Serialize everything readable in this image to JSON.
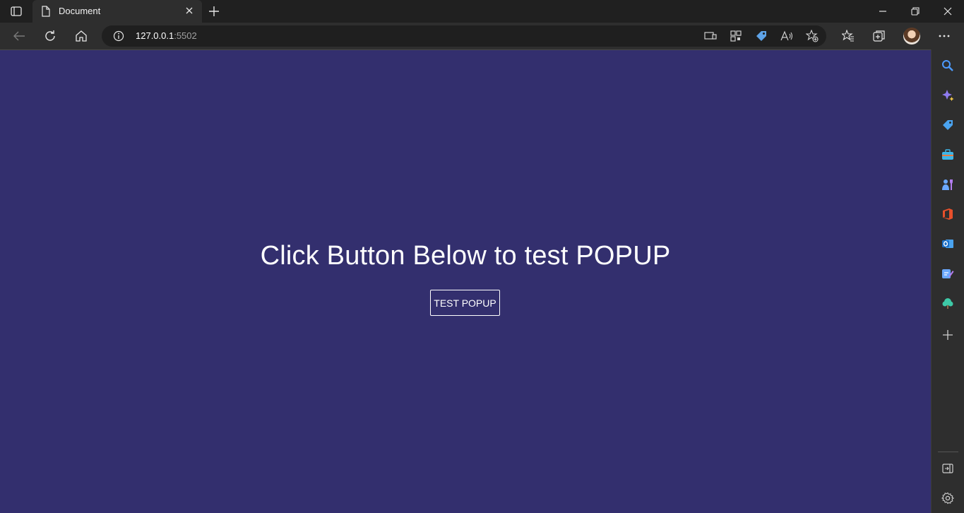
{
  "tab": {
    "title": "Document"
  },
  "address_bar": {
    "host": "127.0.0.1",
    "port": ":5502"
  },
  "page": {
    "heading": "Click Button Below to test POPUP",
    "button_label": "TEST POPUP",
    "background_color": "#332f6e"
  },
  "icons": {
    "tab_actions": "tab-actions-icon",
    "document": "document-icon",
    "close": "close-icon",
    "new_tab": "plus-icon",
    "minimize": "minimize-icon",
    "restore": "restore-icon",
    "window_close": "close-icon",
    "back": "back-arrow-icon",
    "refresh": "refresh-icon",
    "home": "home-icon",
    "info": "info-icon",
    "sidebar": [
      "search-icon",
      "copilot-icon",
      "shopping-tag-icon",
      "tools-icon",
      "games-icon",
      "office-icon",
      "outlook-icon",
      "drop-icon",
      "tree-icon",
      "plus-icon",
      "hide-sidebar-icon",
      "gear-icon"
    ]
  }
}
